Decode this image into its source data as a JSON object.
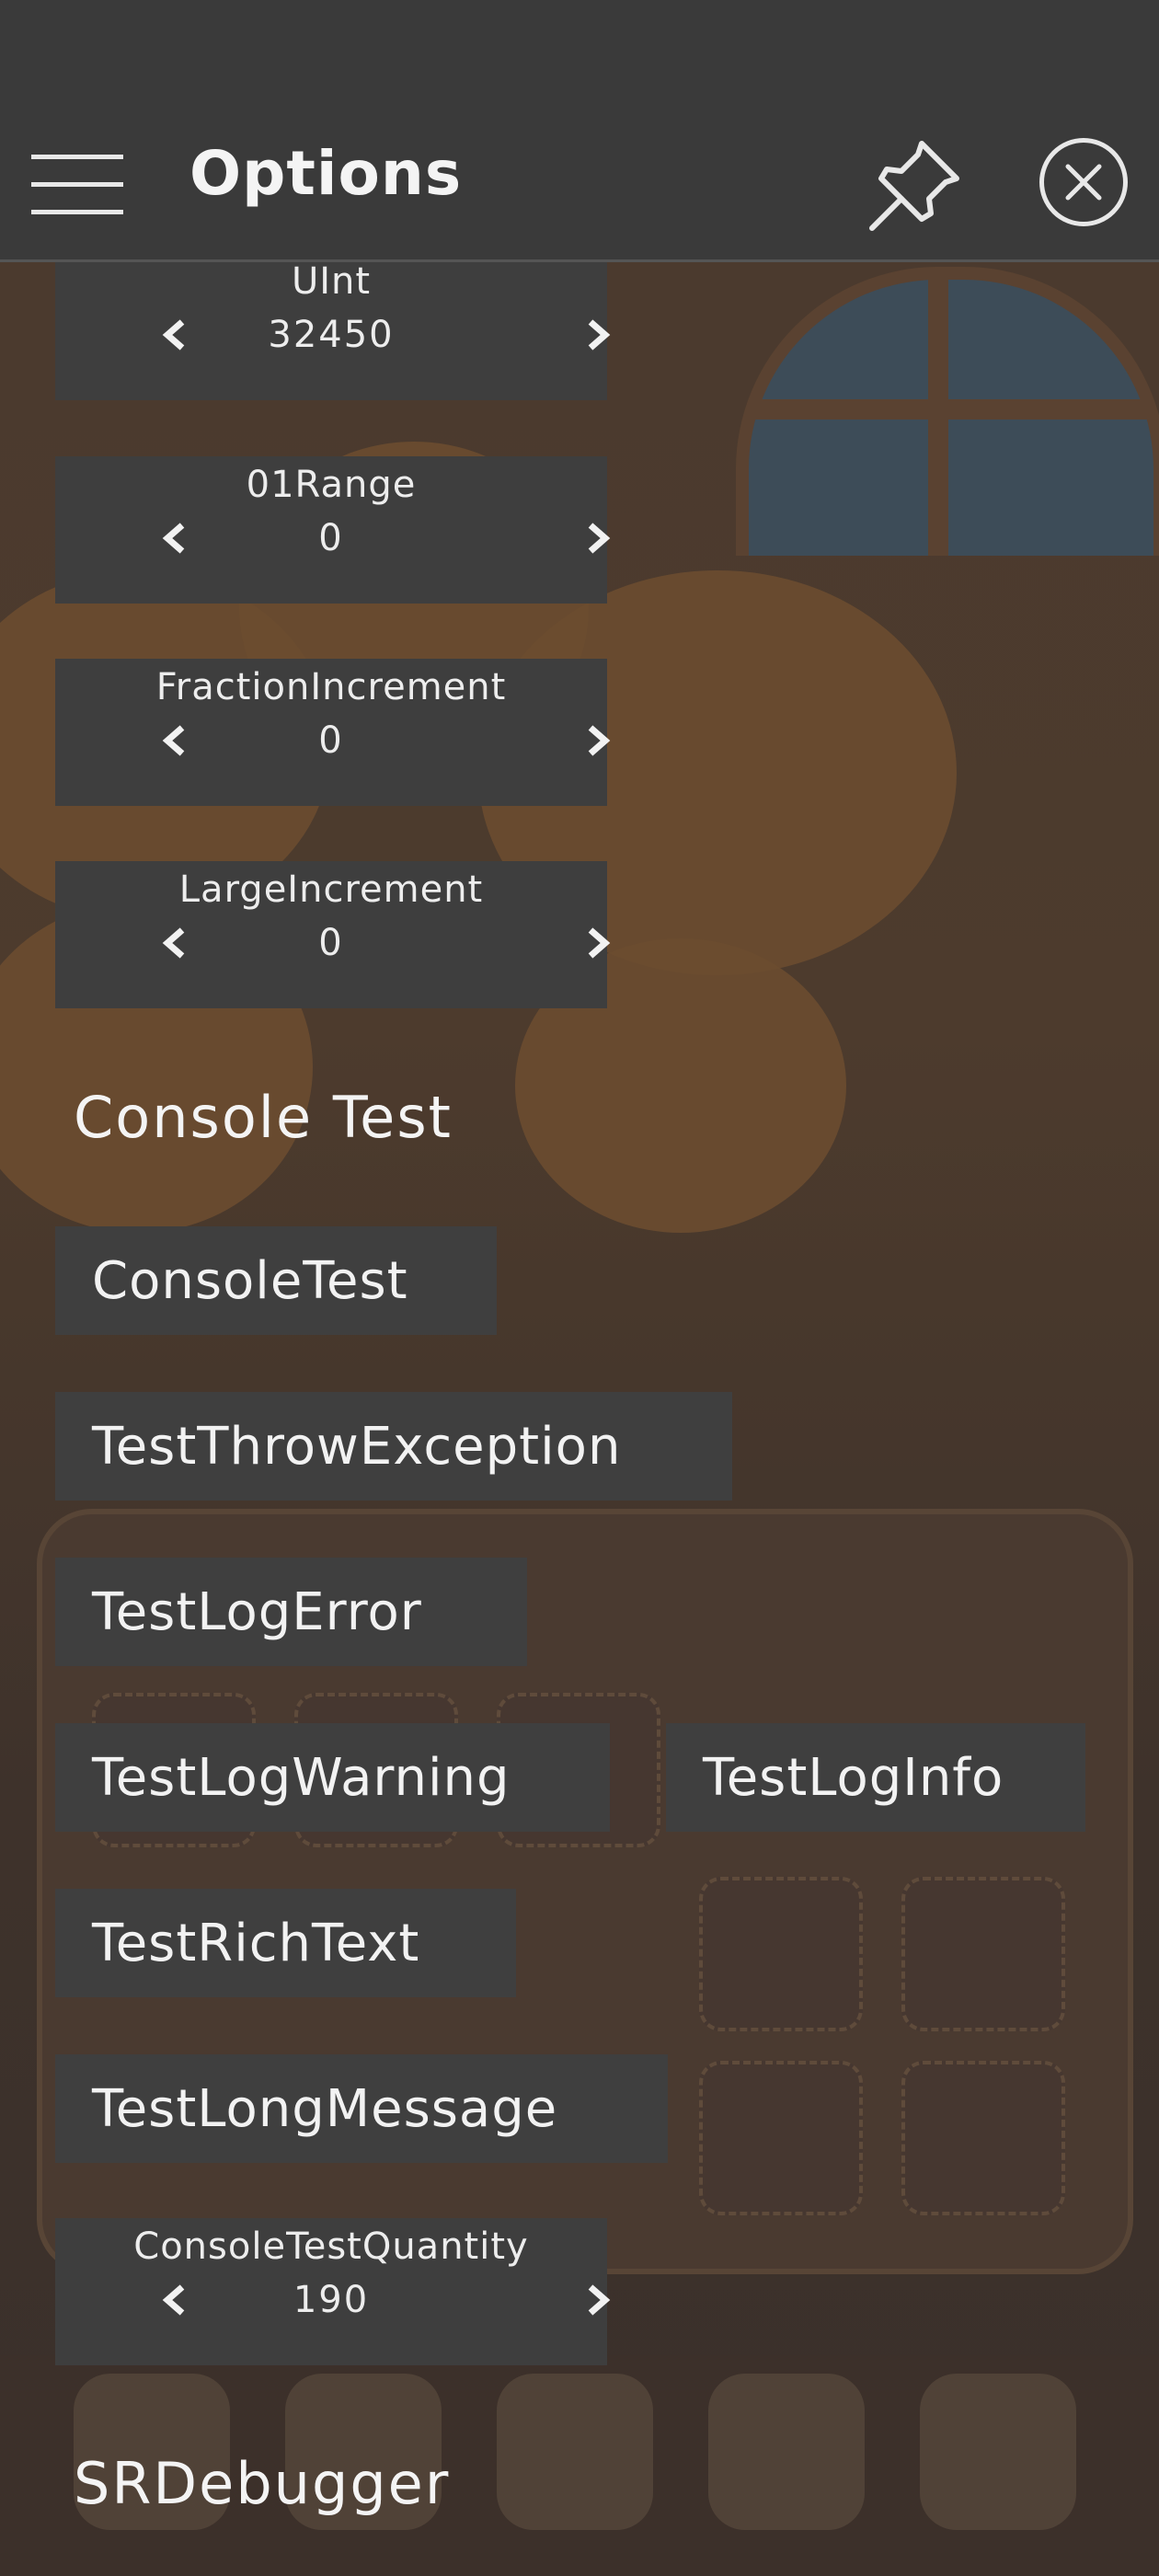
{
  "header": {
    "title": "Options",
    "menu_icon": "hamburger-menu-icon",
    "pin_icon": "pin-icon",
    "close_icon": "close-circle-icon"
  },
  "numbers": [
    {
      "label": "UInt",
      "value": "32450"
    },
    {
      "label": "01Range",
      "value": "0"
    },
    {
      "label": "FractionIncrement",
      "value": "0"
    },
    {
      "label": "LargeIncrement",
      "value": "0"
    }
  ],
  "console_section": {
    "title": "Console Test",
    "buttons": {
      "console_test": "ConsoleTest",
      "throw_exception": "TestThrowException",
      "log_error": "TestLogError",
      "log_warning": "TestLogWarning",
      "log_info": "TestLogInfo",
      "rich_text": "TestRichText",
      "long_message": "TestLongMessage"
    },
    "quantity": {
      "label": "ConsoleTestQuantity",
      "value": "190"
    }
  },
  "srdebugger_section": {
    "title": "SRDebugger"
  },
  "arrows": {
    "left": "<",
    "right": ">"
  },
  "colors": {
    "panel": "#3a3a3a",
    "button": "#3f3f3f",
    "text": "#f2f2f2"
  }
}
